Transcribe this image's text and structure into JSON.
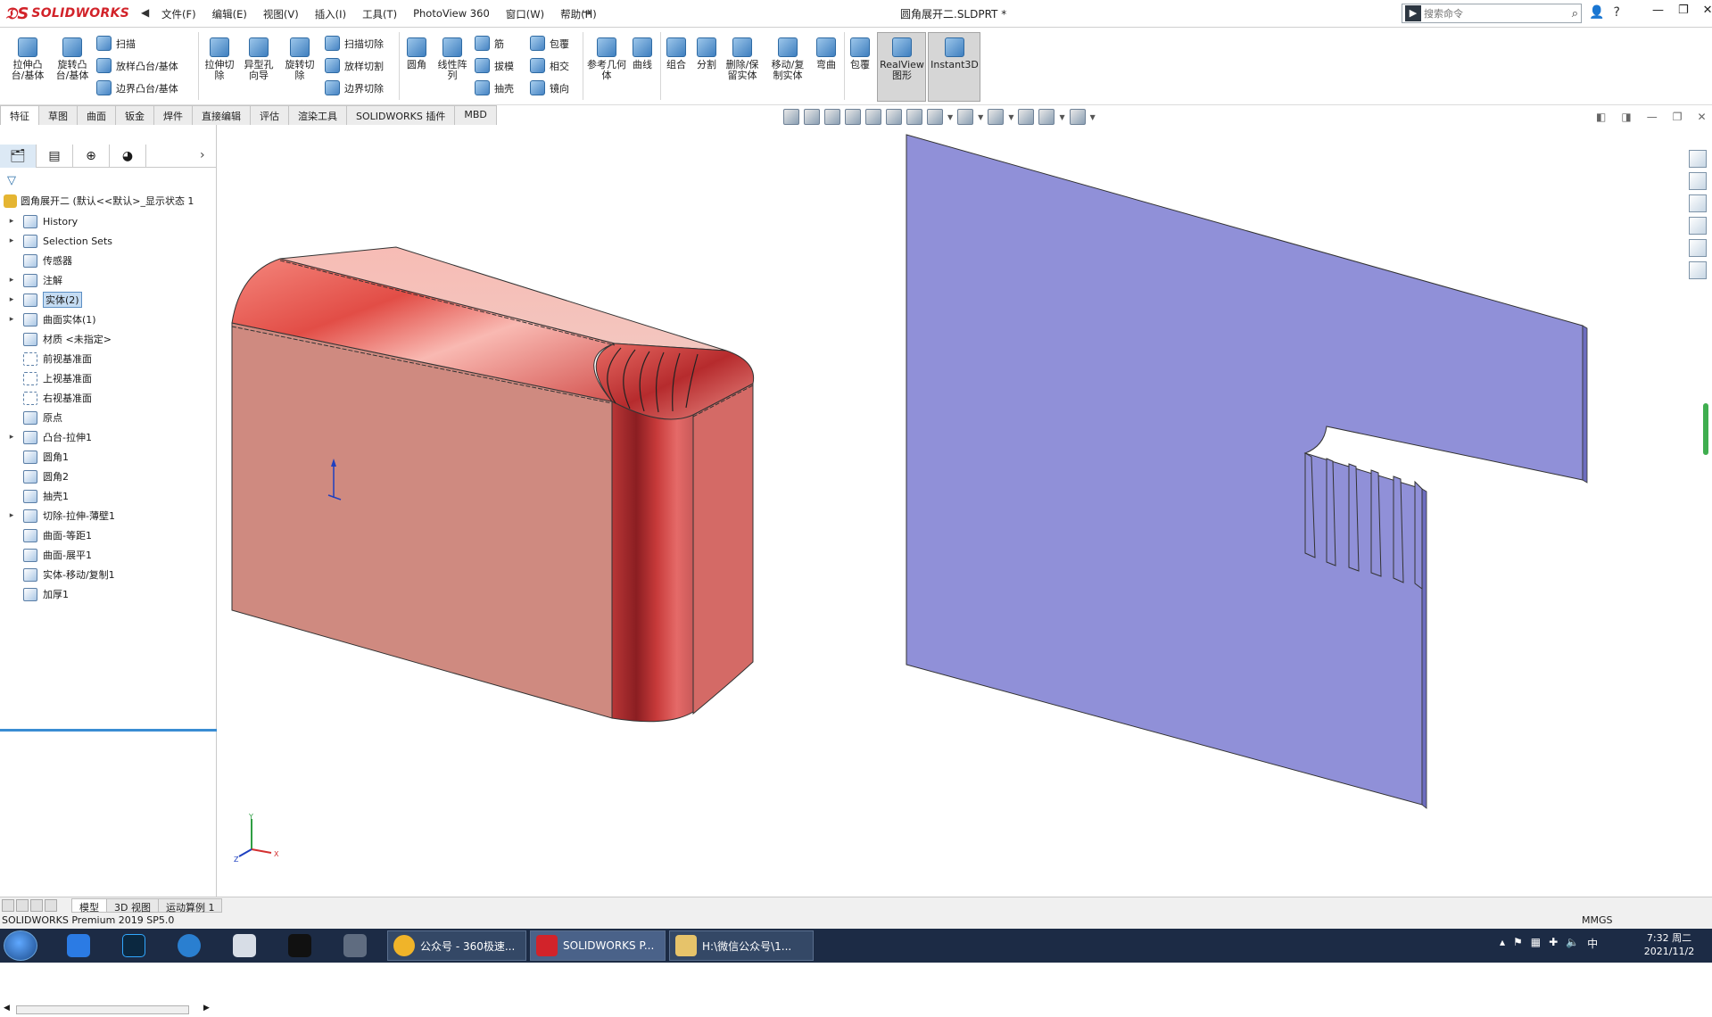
{
  "app": {
    "brand": "SOLIDWORKS",
    "doc_title": "圆角展开二.SLDPRT *",
    "menu": [
      "文件(F)",
      "编辑(E)",
      "视图(V)",
      "插入(I)",
      "工具(T)",
      "PhotoView 360",
      "窗口(W)",
      "帮助(H)"
    ],
    "search_placeholder": "搜索命令"
  },
  "toolbar": {
    "extrude_boss": "拉伸凸台/基体",
    "revolve_boss": "旋转凸台/基体",
    "sweep": "扫描",
    "loft": "放样凸台/基体",
    "boundary": "边界凸台/基体",
    "extrude_cut": "拉伸切除",
    "hole_wizard": "异型孔向导",
    "revolve_cut": "旋转切除",
    "sweep_cut": "扫描切除",
    "loft_cut": "放样切割",
    "boundary_cut": "边界切除",
    "fillet": "圆角",
    "linear_pattern": "线性阵列",
    "rib": "筋",
    "draft": "拔模",
    "shell": "抽壳",
    "wrap": "包覆",
    "intersect": "相交",
    "mirror": "镜向",
    "ref_geometry": "参考几何体",
    "curves": "曲线",
    "combine": "组合",
    "split": "分割",
    "delete_keep_body": "删除/保留实体",
    "move_copy_body": "移动/复制实体",
    "flex": "弯曲",
    "wrap2": "包覆",
    "realview": "RealView 图形",
    "instant3d": "Instant3D"
  },
  "tabs": [
    "特征",
    "草图",
    "曲面",
    "钣金",
    "焊件",
    "直接编辑",
    "评估",
    "渲染工具",
    "SOLIDWORKS 插件",
    "MBD"
  ],
  "tree": {
    "root": "圆角展开二 (默认<<默认>_显示状态 1",
    "items": [
      {
        "label": "History",
        "expand": "▸"
      },
      {
        "label": "Selection Sets",
        "expand": "▸"
      },
      {
        "label": "传感器",
        "expand": ""
      },
      {
        "label": "注解",
        "expand": "▸"
      },
      {
        "label": "实体(2)",
        "expand": "▸"
      },
      {
        "label": "曲面实体(1)",
        "expand": "▸"
      },
      {
        "label": "材质 <未指定>",
        "expand": ""
      },
      {
        "label": "前视基准面",
        "expand": ""
      },
      {
        "label": "上视基准面",
        "expand": ""
      },
      {
        "label": "右视基准面",
        "expand": ""
      },
      {
        "label": "原点",
        "expand": ""
      },
      {
        "label": "凸台-拉伸1",
        "expand": "▸"
      },
      {
        "label": "圆角1",
        "expand": ""
      },
      {
        "label": "圆角2",
        "expand": ""
      },
      {
        "label": "抽壳1",
        "expand": ""
      },
      {
        "label": "切除-拉伸-薄壁1",
        "expand": "▸"
      },
      {
        "label": "曲面-等距1",
        "expand": ""
      },
      {
        "label": "曲面-展平1",
        "expand": ""
      },
      {
        "label": "实体-移动/复制1",
        "expand": ""
      },
      {
        "label": "加厚1",
        "expand": ""
      }
    ]
  },
  "bottom_tabs": [
    "模型",
    "3D 视图",
    "运动算例 1"
  ],
  "status": {
    "text": "SOLIDWORKS Premium 2019 SP5.0",
    "units": "MMGS"
  },
  "taskbar": {
    "btn1": "公众号 - 360极速...",
    "btn2": "SOLIDWORKS P...",
    "btn3": "H:\\微信公众号\\1...",
    "time": "7:32 周二",
    "date": "2021/11/2"
  },
  "colors": {
    "brand_red": "#d2232a",
    "box_face": "#e08c86",
    "sheet": "#9090d8",
    "taskbar": "#1c2b45"
  }
}
